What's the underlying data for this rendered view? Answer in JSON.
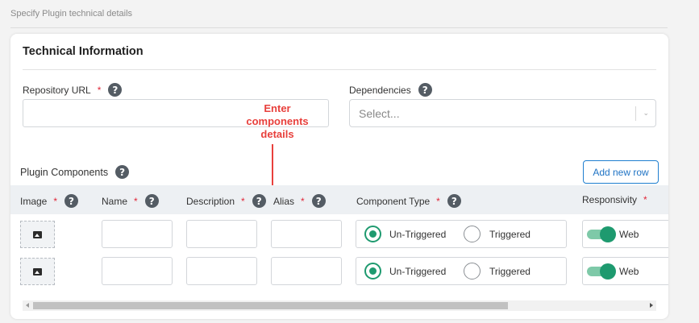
{
  "page": {
    "subtitle": "Specify Plugin technical details"
  },
  "card": {
    "title": "Technical Information"
  },
  "fields": {
    "repository_url": {
      "label": "Repository URL",
      "required": "*",
      "value": ""
    },
    "dependencies": {
      "label": "Dependencies",
      "placeholder": "Select..."
    }
  },
  "annotation": {
    "text_line1": "Enter",
    "text_line2": "components",
    "text_line3": "details"
  },
  "components": {
    "title": "Plugin Components",
    "add_row_label": "Add new row",
    "columns": [
      {
        "label": "Image",
        "required": "*"
      },
      {
        "label": "Name",
        "required": "*"
      },
      {
        "label": "Description",
        "required": "*"
      },
      {
        "label": "Alias",
        "required": "*"
      },
      {
        "label": "Component Type",
        "required": "*"
      },
      {
        "label": "Responsivity",
        "required": "*"
      }
    ],
    "rows": [
      {
        "name": "",
        "description": "",
        "alias": "",
        "component_type": "Un-Triggered",
        "options": [
          "Un-Triggered",
          "Triggered"
        ],
        "responsivity": "Web",
        "web_enabled": true
      },
      {
        "name": "",
        "description": "",
        "alias": "",
        "component_type": "Un-Triggered",
        "options": [
          "Un-Triggered",
          "Triggered"
        ],
        "responsivity": "Web",
        "web_enabled": true
      }
    ]
  },
  "icons": {
    "help": "question-circle-icon",
    "image": "image-icon",
    "dropdown": "chevron-down-icon"
  },
  "colors": {
    "accent_green": "#1e9a6f",
    "required_red": "#e0283a",
    "annotation_red": "#e8403c",
    "button_blue": "#1f73c4"
  }
}
